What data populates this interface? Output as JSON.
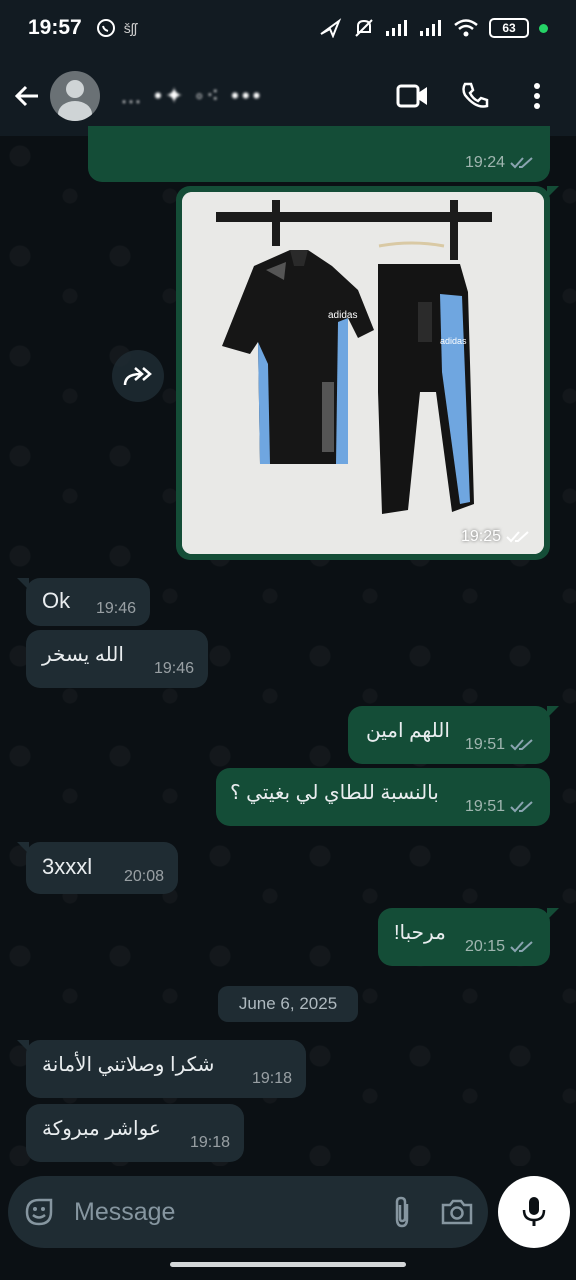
{
  "status_bar": {
    "time": "19:57",
    "battery": "63",
    "extra": "šʃʃ"
  },
  "header": {
    "contact_name": "… •✦ ◦⁖ •••"
  },
  "messages": [
    {
      "id": "m1",
      "direction": "out",
      "time": "19:24",
      "read": true
    },
    {
      "id": "m2",
      "direction": "out",
      "type": "image",
      "time": "19:25",
      "read": true
    },
    {
      "id": "m3",
      "direction": "in",
      "text": "Ok",
      "time": "19:46"
    },
    {
      "id": "m4",
      "direction": "in",
      "text": "الله يسخر",
      "time": "19:46"
    },
    {
      "id": "m5",
      "direction": "out",
      "text": "اللهم امين",
      "time": "19:51",
      "read": true
    },
    {
      "id": "m6",
      "direction": "out",
      "text": "بالنسبة للطاي لي بغيتي ؟",
      "time": "19:51",
      "read": true
    },
    {
      "id": "m7",
      "direction": "in",
      "text": "3xxxl",
      "time": "20:08"
    },
    {
      "id": "m8",
      "direction": "out",
      "text": "مرحبا!",
      "time": "20:15",
      "read": true
    },
    {
      "id": "m9",
      "direction": "in",
      "text": "شكرا وصلاتني الأمانة",
      "time": "19:18"
    },
    {
      "id": "m10",
      "direction": "in",
      "text": "عواشر مبروكة",
      "time": "19:18"
    }
  ],
  "date_divider": "June 6, 2025",
  "composer": {
    "placeholder": "Message"
  },
  "colors": {
    "outgoing_bubble": "#144d37",
    "incoming_bubble": "#1f2c33",
    "background": "#0b1014",
    "read_ticks": "#8aa4b0"
  }
}
